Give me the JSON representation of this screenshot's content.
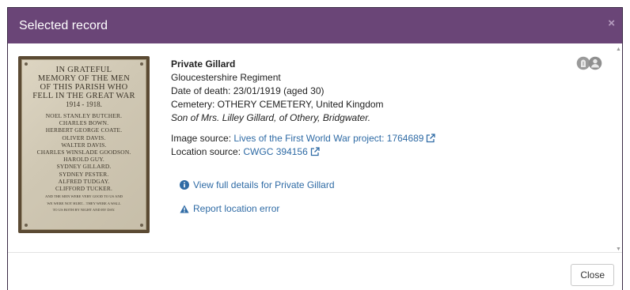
{
  "modal": {
    "title": "Selected record",
    "close_symbol": "×"
  },
  "plaque": {
    "heading": [
      "IN GRATEFUL",
      "MEMORY OF THE MEN",
      "OF THIS PARISH WHO",
      "FELL IN THE GREAT WAR"
    ],
    "years": "1914 - 1918.",
    "names": [
      "NOEL STANLEY BUTCHER.",
      "CHARLES BOWN.",
      "HERBERT GEORGE COATE.",
      "OLIVER DAVIS.",
      "WALTER DAVIS.",
      "CHARLES WINSLADE GOODSON.",
      "HAROLD GUY.",
      "SYDNEY GILLARD.",
      "SYDNEY PESTER.",
      "ALFRED TUDGAY.",
      "CLIFFORD TUCKER."
    ],
    "footer": [
      "AND THE MEN WERE VERY GOOD TO US AND",
      "WE WERE NOT HURT... THEY WERE A WALL",
      "TO US BOTH BY NIGHT AND BY DAY."
    ]
  },
  "record": {
    "name": "Private Gillard",
    "regiment": "Gloucestershire Regiment",
    "date_of_death": "Date of death: 23/01/1919 (aged 30)",
    "cemetery": "Cemetery: OTHERY CEMETERY, United Kingdom",
    "description": "Son of Mrs. Lilley Gillard, of Othery, Bridgwater.",
    "image_source_label": "Image source: ",
    "image_source_link": "Lives of the First World War project: 1764689",
    "location_source_label": "Location source: ",
    "location_source_link": "CWGC 394156"
  },
  "actions": {
    "view_details": "View full details for Private Gillard",
    "report_error": "Report location error"
  },
  "icons": {
    "status": [
      "headstone-icon",
      "person-icon"
    ],
    "link_color": "#2f6ba5",
    "header_color": "#6a4577"
  },
  "footer": {
    "close_label": "Close"
  }
}
